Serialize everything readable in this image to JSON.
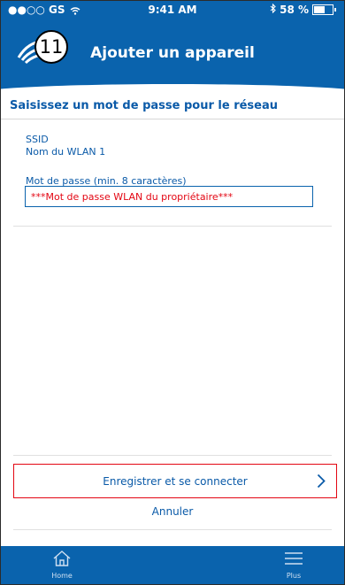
{
  "status_bar": {
    "carrier": "●●○○ GS",
    "wifi": "wifi-icon",
    "time": "9:41 AM",
    "bluetooth": "bluetooth-icon",
    "battery": "58 %",
    "battery_level": 0.58
  },
  "header": {
    "step": "11",
    "title": "Ajouter un appareil"
  },
  "section": {
    "title": "Saisissez un mot de passe pour le réseau"
  },
  "form": {
    "ssid_label": "SSID",
    "ssid_value": "Nom du WLAN 1",
    "password_label": "Mot de passe (min. 8 caractères)",
    "password_value": "***Mot de passe WLAN du propriétaire***"
  },
  "actions": {
    "save_label": "Enregistrer et se connecter",
    "cancel_label": "Annuler"
  },
  "tabbar": {
    "home_label": "Home",
    "more_label": "Plus"
  },
  "colors": {
    "brand_blue": "#0a63ad",
    "text_blue": "#0a5aa8",
    "highlight_red": "#e30613"
  }
}
